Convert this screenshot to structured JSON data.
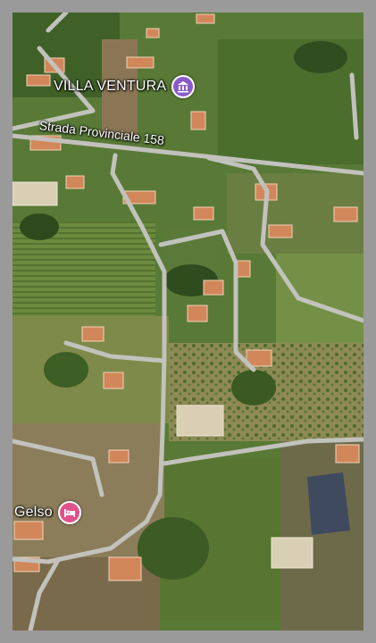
{
  "map": {
    "roads": [
      {
        "name": "Strada Provinciale 158"
      }
    ],
    "places": [
      {
        "name": "VILLA VENTURA",
        "category": "museum-icon",
        "pin_color": "#8b5cc7"
      },
      {
        "name": "Gelso",
        "category": "hotel-bed-icon",
        "pin_color": "#e0528c"
      }
    ]
  }
}
